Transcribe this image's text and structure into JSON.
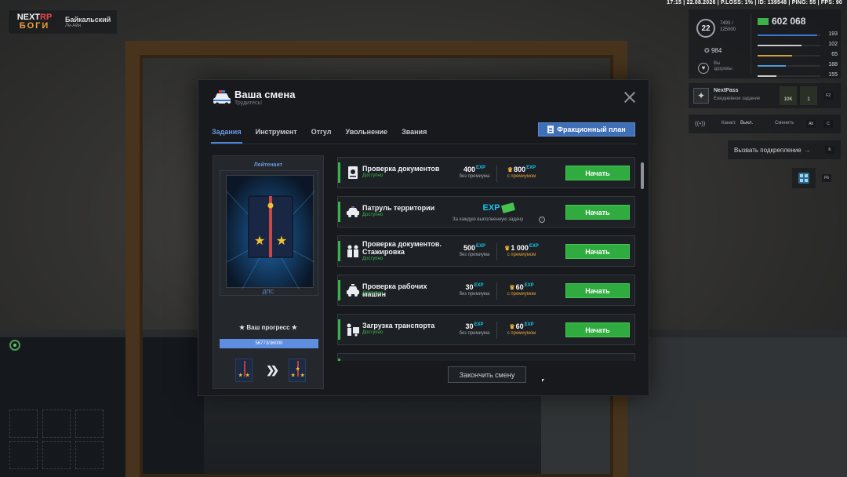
{
  "hud": {
    "topbar": "17:15 | 22.08.2026 | P.LOSS: 1% | ID: 139548 | PING: 55 | FPS: 90",
    "logo_top": "NEXT",
    "logo_rp": "RP",
    "logo_bottom": "БОГИ",
    "server_name": "Байкальский",
    "server_sub": "Ле-Айн",
    "level": "22",
    "level_exp_top": "7493 /",
    "level_exp_bottom": "125000",
    "rating": "984",
    "health_top": "Вы",
    "health_bottom": "здоровы",
    "money": "602 068",
    "stats": [
      {
        "value": "193",
        "color": "#3a78d6",
        "fraction": 0.95
      },
      {
        "value": "102",
        "color": "#c9c9c9",
        "fraction": 0.7
      },
      {
        "value": "65",
        "color": "#d3a23a",
        "fraction": 0.55
      },
      {
        "value": "188",
        "color": "#4e9ad0",
        "fraction": 0.45
      },
      {
        "value": "155",
        "color": "#c9c9c9",
        "fraction": 0.3
      }
    ],
    "nextpass_title": "NextPass",
    "nextpass_sub": "Ежедневное задание",
    "nextpass_reward1": "10K",
    "nextpass_reward2": "1",
    "nextpass_key": "F2",
    "channel_label": "Канал:",
    "channel_value": "Выкл.",
    "channel_change": "Сменить",
    "channel_key1": "Alt",
    "channel_key2": "C",
    "backup_label": "Вызвать подкрепление",
    "backup_key": "K",
    "phone_key": "F6"
  },
  "modal": {
    "title": "Ваша смена",
    "subtitle": "Трудитесь!",
    "tabs": [
      "Задания",
      "Инструмент",
      "Отгул",
      "Увольнение",
      "Звания"
    ],
    "faction_plan": "Фракционный план",
    "end_shift": "Закончить смену",
    "rank": {
      "title": "Лейтенант",
      "department": "ДПС",
      "progress_label": "★ Ваш прогресс ★",
      "progress_text": "56773/36000",
      "progress_fraction": 1.0
    },
    "tasks": [
      {
        "name": "Проверка документов",
        "status": "Доступно",
        "base": "400",
        "premium": "800",
        "base_label": "без премиума",
        "premium_label": "с премиумом",
        "button": "Начать",
        "icon": "passport-icon"
      },
      {
        "name": "Патруль территории",
        "status": "Доступно",
        "special_note": "За каждую выполненную задачу",
        "button": "Начать",
        "icon": "police-car-icon"
      },
      {
        "name": "Проверка документов. Стажировка",
        "status": "Доступно",
        "base": "500",
        "premium": "1 000",
        "base_label": "без премиума",
        "premium_label": "с премиумом",
        "button": "Начать",
        "icon": "officers-icon"
      },
      {
        "name": "Проверка рабочих машин",
        "status": "Доступно",
        "base": "30",
        "premium": "60",
        "base_label": "без премиума",
        "premium_label": "с премиумом",
        "button": "Начать",
        "icon": "car-check-icon"
      },
      {
        "name": "Загрузка транспорта",
        "status": "Доступно",
        "base": "30",
        "premium": "60",
        "base_label": "без премиума",
        "premium_label": "с премиумом",
        "button": "Начать",
        "icon": "loading-icon"
      }
    ],
    "exp_label": "EXP"
  }
}
